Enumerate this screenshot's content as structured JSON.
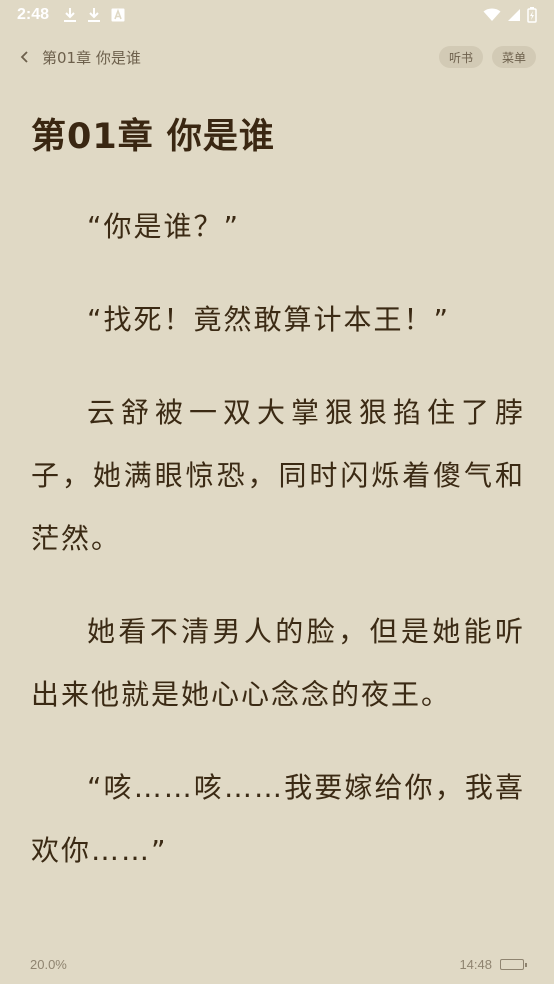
{
  "status_bar": {
    "time": "2:48",
    "left_icons": [
      "download-icon",
      "download-icon",
      "a-badge-icon"
    ],
    "right_icons": [
      "wifi-icon",
      "signal-icon",
      "battery-charging-icon"
    ]
  },
  "nav": {
    "title": "第01章 你是谁",
    "listen_label": "听书",
    "menu_label": "菜单"
  },
  "chapter": {
    "title": "第01章 你是谁",
    "paragraphs": [
      "“你是谁？”",
      "“找死！竟然敢算计本王！”",
      "云舒被一双大掌狠狠掐住了脖子，她满眼惊恐，同时闪烁着傻气和茫然。",
      "她看不清男人的脸，但是她能听出来他就是她心心念念的夜王。",
      "“咳……咳……我要嫁给你，我喜欢你……”"
    ]
  },
  "footer": {
    "progress": "20.0%",
    "time": "14:48"
  },
  "colors": {
    "background": "#e0d9c5",
    "text": "#3b2a14",
    "pill": "#d2cab5"
  }
}
